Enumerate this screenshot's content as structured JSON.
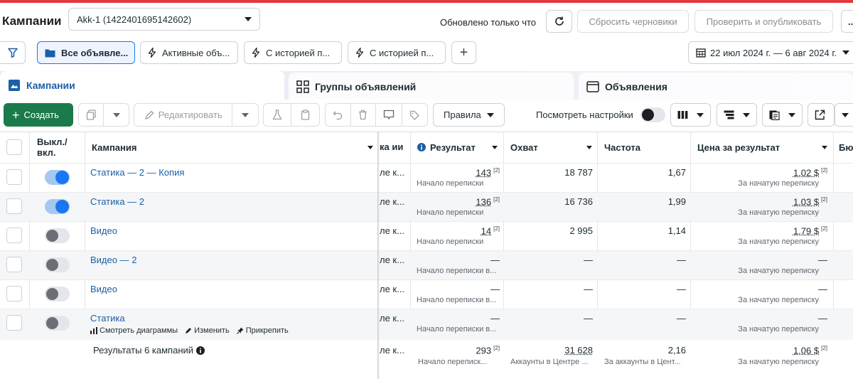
{
  "header": {
    "title": "Кампании",
    "account_select": "Akk-1 (1422401695142602)",
    "updated": "Обновлено только что",
    "reset_drafts": "Сбросить черновики",
    "review_publish": "Проверить и опубликовать",
    "more": "..."
  },
  "views": {
    "tabs": [
      {
        "label": "Все объявле..."
      },
      {
        "label": "Активные объ..."
      },
      {
        "label": "С историей п..."
      },
      {
        "label": "С историей п..."
      }
    ],
    "add": "+",
    "date_range": "22 июл 2024 г. — 6 авг 2024 г."
  },
  "levels": {
    "campaigns": "Кампании",
    "adsets": "Группы объявлений",
    "ads": "Объявления"
  },
  "toolbar": {
    "create": "Создать",
    "edit": "Редактировать",
    "rules": "Правила",
    "view_settings": "Посмотреть настройки"
  },
  "table": {
    "columns": {
      "toggle": "Выкл./ вкл.",
      "campaign": "Кампания",
      "cut": "ка ии",
      "result": "Результат",
      "reach": "Охват",
      "frequency": "Частота",
      "cost": "Цена за результат",
      "budget": "Бюд"
    },
    "rows": [
      {
        "name": "Статика — 2 — Копия",
        "on": true,
        "cut": "ле к...",
        "result": "143",
        "result_type": "Начало переписки",
        "reach": "18 787",
        "frequency": "1,67",
        "cost": "1,02 $",
        "cost_type": "За начатую переписку"
      },
      {
        "name": "Статика — 2",
        "on": true,
        "cut": "ле к...",
        "result": "136",
        "result_type": "Начало переписки",
        "reach": "16 736",
        "frequency": "1,99",
        "cost": "1,03 $",
        "cost_type": "За начатую переписку"
      },
      {
        "name": "Видео",
        "on": false,
        "cut": "ле к...",
        "result": "14",
        "result_type": "Начало переписки",
        "reach": "2 995",
        "frequency": "1,14",
        "cost": "1,79 $",
        "cost_type": "За начатую переписку"
      },
      {
        "name": "Видео — 2",
        "on": false,
        "cut": "ле к...",
        "result": "—",
        "result_type": "Начало переписки в...",
        "reach": "—",
        "frequency": "—",
        "cost": "—",
        "cost_type": "За начатую переписку"
      },
      {
        "name": "Видео",
        "on": false,
        "cut": "ле к...",
        "result": "—",
        "result_type": "Начало переписки в...",
        "reach": "—",
        "frequency": "—",
        "cost": "—",
        "cost_type": "За начатую переписку"
      },
      {
        "name": "Статика",
        "on": false,
        "cut": "ле к...",
        "result": "—",
        "result_type": "Начало переписки в...",
        "reach": "—",
        "frequency": "—",
        "cost": "—",
        "cost_type": "За начатую переписку"
      }
    ],
    "row_actions": {
      "charts": "Смотреть диаграммы",
      "edit": "Изменить",
      "pin": "Прикрепить"
    },
    "summary": {
      "label": "Результаты 6 кампаний",
      "cut": "ле к...",
      "result": "293",
      "result_type": "Начало переписк...",
      "reach": "31 628",
      "reach_type": "Аккаунты в Центре ...",
      "frequency": "2,16",
      "frequency_type": "За аккаунты в Цент...",
      "cost": "1,06 $",
      "cost_type": "За начатую переписку"
    },
    "footnote": "[2]"
  }
}
